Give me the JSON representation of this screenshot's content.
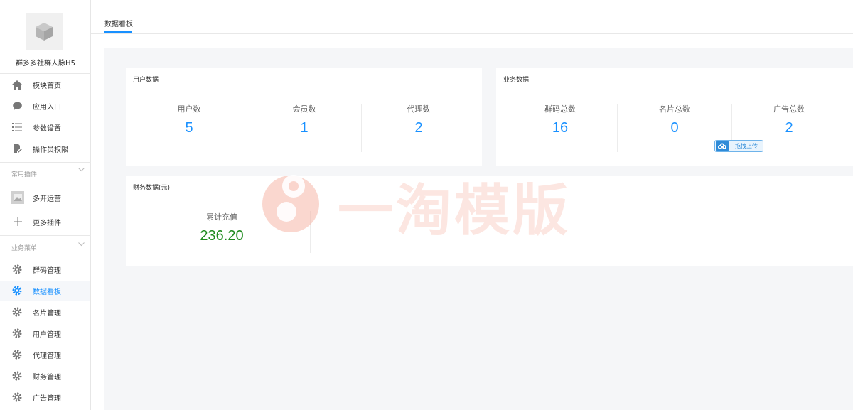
{
  "sidebar": {
    "app_name": "群多多社群人脉H5",
    "top_items": [
      {
        "label": "模块首页",
        "icon": "home-icon"
      },
      {
        "label": "应用入口",
        "icon": "chat-icon"
      },
      {
        "label": "参数设置",
        "icon": "list-icon"
      },
      {
        "label": "操作员权限",
        "icon": "edit-doc-icon"
      }
    ],
    "plugins_group": {
      "title": "常用插件",
      "items": [
        {
          "label": "多开运营",
          "icon": "image-icon"
        },
        {
          "label": "更多插件",
          "icon": "plus-icon"
        }
      ]
    },
    "business_group": {
      "title": "业务菜单",
      "items": [
        {
          "label": "群码管理",
          "icon": "gear-icon"
        },
        {
          "label": "数据看板",
          "icon": "gear-icon",
          "active": true
        },
        {
          "label": "名片管理",
          "icon": "gear-icon"
        },
        {
          "label": "用户管理",
          "icon": "gear-icon"
        },
        {
          "label": "代理管理",
          "icon": "gear-icon"
        },
        {
          "label": "财务管理",
          "icon": "gear-icon"
        },
        {
          "label": "广告管理",
          "icon": "gear-icon"
        }
      ]
    }
  },
  "tabs": {
    "active": "数据看板"
  },
  "user_card": {
    "title": "用户数据",
    "stats": [
      {
        "name": "用户数",
        "value": "5"
      },
      {
        "name": "会员数",
        "value": "1"
      },
      {
        "name": "代理数",
        "value": "2"
      }
    ]
  },
  "business_card": {
    "title": "业务数据",
    "stats": [
      {
        "name": "群码总数",
        "value": "16"
      },
      {
        "name": "名片总数",
        "value": "0"
      },
      {
        "name": "广告总数",
        "value": "2"
      }
    ],
    "upload_label": "拖拽上传"
  },
  "finance_card": {
    "title": "财务数据(元)",
    "stats": [
      {
        "name": "累计充值",
        "value": "236.20"
      }
    ]
  },
  "watermark": {
    "text": "一淘模版"
  },
  "colors": {
    "accent": "#1890ff",
    "finance_green": "#1e8a1e",
    "background": "#f5f6f8"
  }
}
